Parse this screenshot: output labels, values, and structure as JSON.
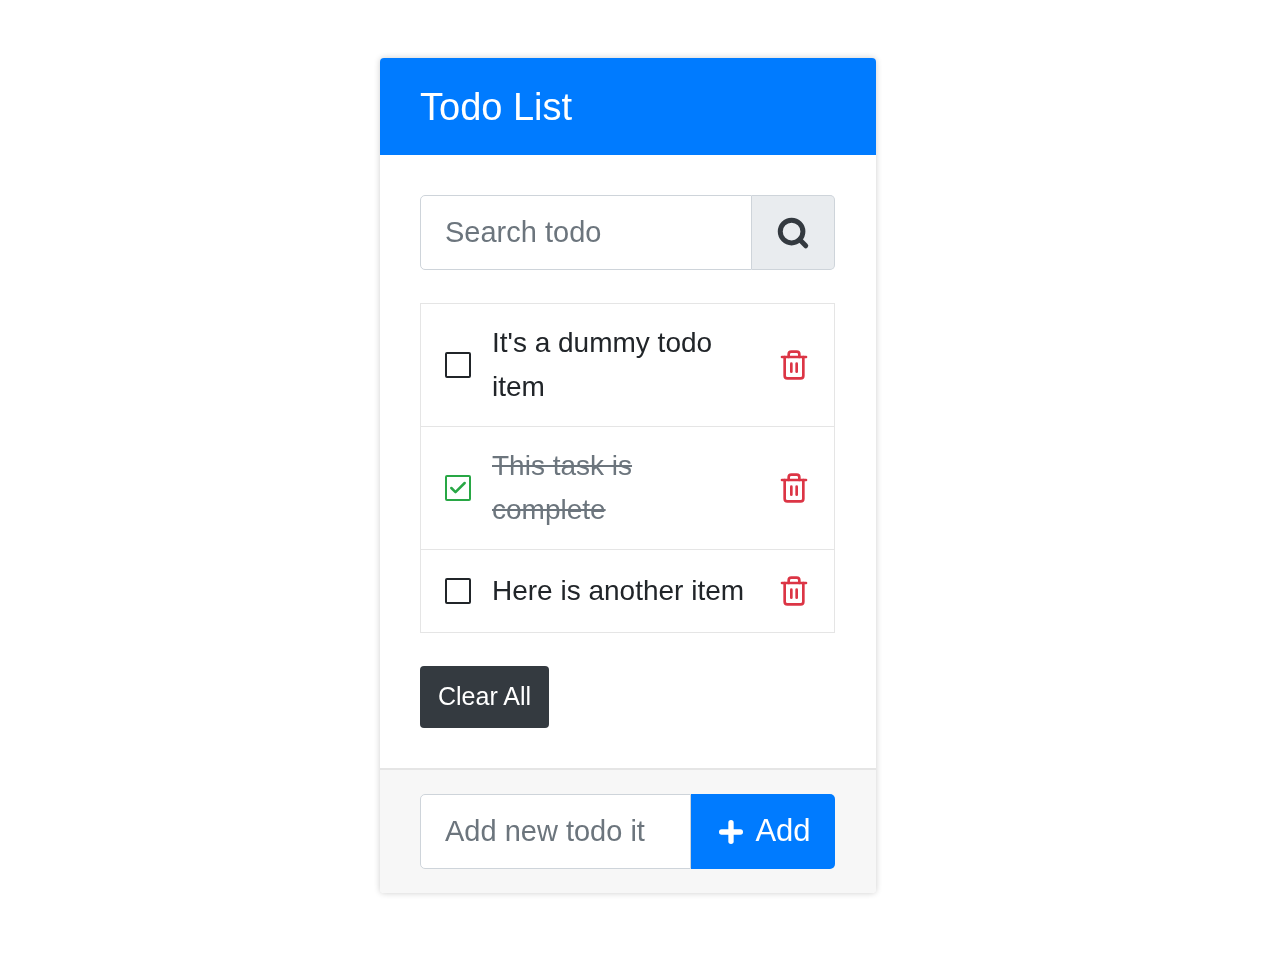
{
  "header": {
    "title": "Todo List"
  },
  "search": {
    "placeholder": "Search todo"
  },
  "todos": [
    {
      "text": "It's a dummy todo item",
      "checked": false
    },
    {
      "text": "This task is complete",
      "checked": true
    },
    {
      "text": "Here is another item",
      "checked": false
    }
  ],
  "clear_button": "Clear All",
  "add": {
    "placeholder": "Add new todo it",
    "button": "Add"
  }
}
